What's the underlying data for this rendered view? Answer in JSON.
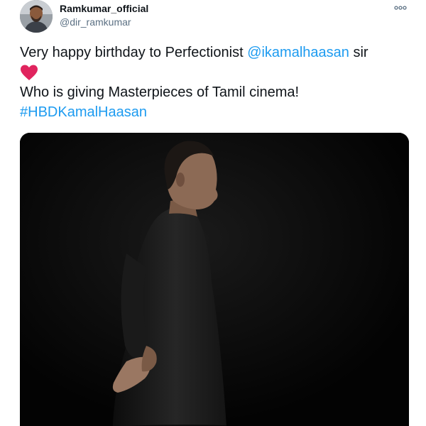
{
  "author": {
    "display_name": "Ramkumar_official",
    "handle": "@dir_ramkumar"
  },
  "tweet": {
    "line1_prefix": "Very happy birthday to Perfectionist ",
    "mention": "@ikamalhaasan",
    "line1_suffix": " sir",
    "line3": "Who is giving Masterpieces of Tamil cinema!",
    "hashtag": "#HBDKamalHaasan"
  },
  "icons": {
    "more": "more-options-icon",
    "heart": "red-heart-icon"
  },
  "colors": {
    "link": "#1d9bf0",
    "text": "#0f1419",
    "secondary": "#5b7083",
    "heart": "#e0245e"
  }
}
